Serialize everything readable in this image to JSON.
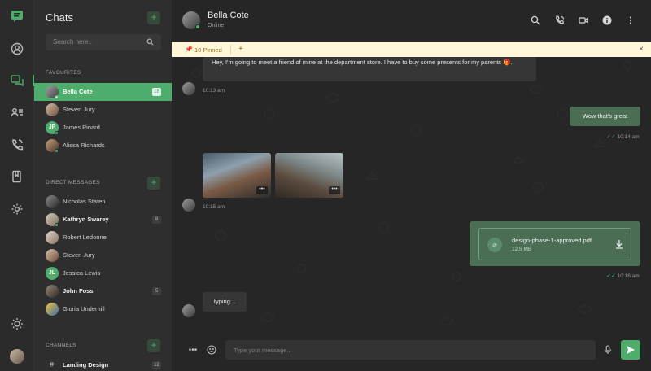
{
  "app": {
    "accent": "#4eac6d"
  },
  "rail": {
    "icons": [
      "chat-logo-icon",
      "profile-icon",
      "chats-icon",
      "contacts-icon",
      "calls-icon",
      "bookmarks-icon",
      "settings-icon",
      "theme-icon"
    ]
  },
  "sidebar": {
    "title": "Chats",
    "search_placeholder": "Search here..",
    "favourites_label": "Favourites",
    "favourites": [
      {
        "name": "Bella Cote",
        "badge": "18",
        "active": true
      },
      {
        "name": "Steven Jury"
      },
      {
        "name": "James Pinard",
        "initials": "JP"
      },
      {
        "name": "Alissa Richards"
      }
    ],
    "direct_label": "Direct Messages",
    "direct": [
      {
        "name": "Nicholas Staten"
      },
      {
        "name": "Kathryn Swarey",
        "badge": "8"
      },
      {
        "name": "Robert Ledonne"
      },
      {
        "name": "Steven Jury"
      },
      {
        "name": "Jessica Lewis",
        "initials": "JL"
      },
      {
        "name": "John Foss",
        "badge": "5"
      },
      {
        "name": "Gloria Underhill"
      }
    ],
    "channels_label": "Channels",
    "channels": [
      {
        "name": "Landing Design",
        "badge": "12"
      }
    ]
  },
  "header": {
    "name": "Bella Cote",
    "status": "Online"
  },
  "pinned": {
    "label": "10 Pinned",
    "add": "+",
    "close": "×"
  },
  "messages": {
    "m1_text": "Hey, I'm going to meet a friend of mine at the department store. I have to buy some presents for my parents 🎁.",
    "m1_time": "10:13 am",
    "m2_text": "Wow that's great",
    "m2_time": "10:14 am",
    "m3_time": "10:15 am",
    "file_name": "design-phase-1-approved.pdf",
    "file_size": "12.5 MB",
    "m4_time": "10:16 am",
    "typing": "typing..."
  },
  "composer": {
    "placeholder": "Type your message..."
  }
}
